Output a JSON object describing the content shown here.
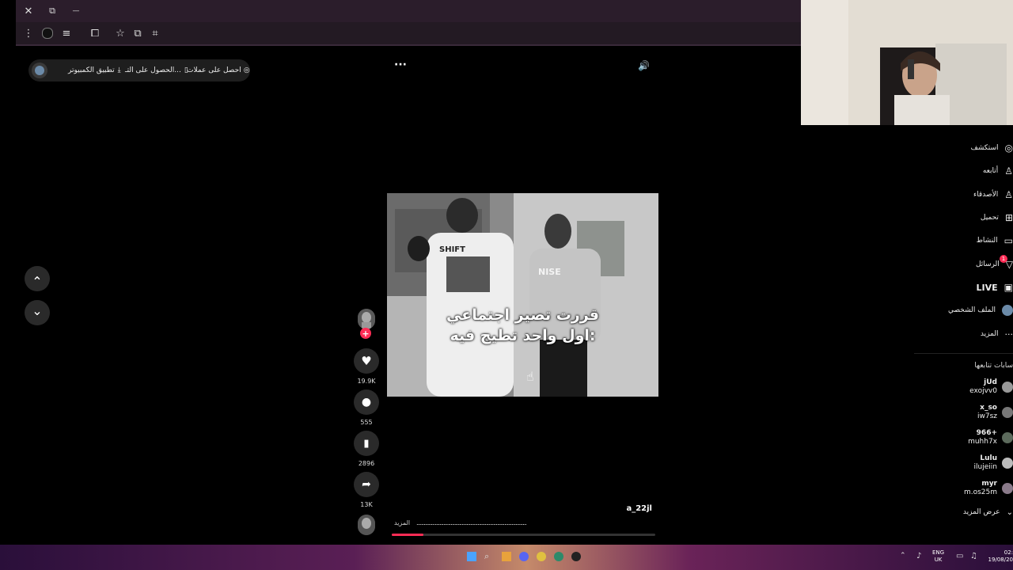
{
  "browser": {
    "titlebar": {
      "close_glyph": "✕",
      "restore_glyph": "⧉",
      "minimize_glyph": "—"
    },
    "toolbar_icons": [
      "menu-icon",
      "profile-icon",
      "reading-list-icon",
      "extensions-icon",
      "bookmark-star-icon",
      "translate-icon",
      "screenshot-icon"
    ]
  },
  "top_bar": {
    "coins_label": "احصل على عملات",
    "get_app_label": "الحصول على التـ...",
    "desktop_app_label": "تطبيق الكمبيوتر",
    "more_glyph": "···",
    "volume_glyph": "🔊"
  },
  "video": {
    "caption_line1": "قررت تصير اجتماعي",
    "caption_line2": "اول واحد تطيح فيه:",
    "shirt_text1": "SHIFT",
    "shirt_text2": "NISE",
    "progress": 0.12
  },
  "actions": {
    "likes": "19.9K",
    "comments": "555",
    "saves": "2896",
    "shares": "13K",
    "follow_glyph": "+"
  },
  "post": {
    "username": "a_22jl",
    "description": "..........................................................................................",
    "more_label": "المزيد"
  },
  "scroll_nav": {
    "up_glyph": "⌃",
    "down_glyph": "⌄"
  },
  "sidebar": {
    "items": [
      {
        "label": "استكشف",
        "icon": "explore-icon",
        "glyph": "◎"
      },
      {
        "label": "أتابعه",
        "icon": "following-icon",
        "glyph": "♙"
      },
      {
        "label": "الأصدقاء",
        "icon": "friends-icon",
        "glyph": "♙"
      },
      {
        "label": "تحميل",
        "icon": "upload-icon",
        "glyph": "⊞"
      },
      {
        "label": "النشاط",
        "icon": "activity-icon",
        "glyph": "▭"
      },
      {
        "label": "الرسائل",
        "icon": "messages-icon",
        "glyph": "▽"
      },
      {
        "label": "LIVE",
        "icon": "live-icon",
        "glyph": "▣"
      },
      {
        "label": "الملف الشخصي",
        "icon": "profile-avatar-icon",
        "glyph": "●"
      },
      {
        "label": "المزيد",
        "icon": "more-icon",
        "glyph": "···"
      }
    ],
    "messages_badge": "1",
    "following_header": "سابات تتابعها",
    "accounts": [
      {
        "name": "jUd",
        "handle": "exojvv0"
      },
      {
        "name": "x_so",
        "handle": "iw7sz"
      },
      {
        "name": "966+",
        "handle": "muhh7x"
      },
      {
        "name": "Lulu",
        "handle": "ilujeiin"
      },
      {
        "name": "myr",
        "handle": "m.os25m"
      }
    ],
    "show_more_label": "عرض المزيد"
  },
  "taskbar": {
    "lang_line1": "ENG",
    "lang_line2": "UK",
    "time": "02:",
    "date": "19/08/20"
  }
}
